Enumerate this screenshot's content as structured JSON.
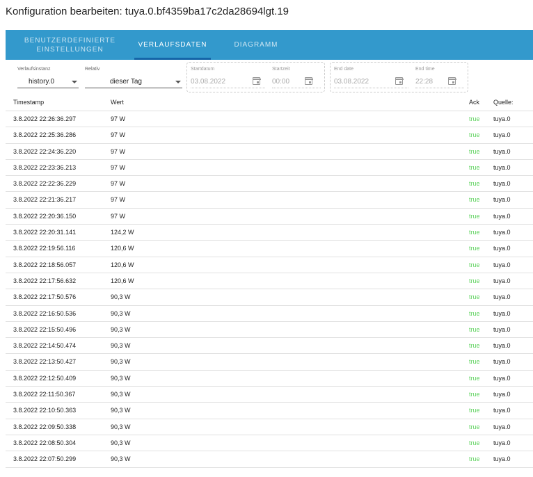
{
  "title": "Konfiguration bearbeiten: tuya.0.bf4359ba17c2da28694lgt.19",
  "tabs": [
    {
      "label_line1": "BENUTZERDEFINIERTE",
      "label_line2": "EINSTELLUNGEN"
    },
    {
      "label": "VERLAUFSDATEN"
    },
    {
      "label": "DIAGRAMM"
    }
  ],
  "controls": {
    "instance_label": "Verlaufsinstanz",
    "instance_value": "history.0",
    "relative_label": "Relativ",
    "relative_value": "dieser Tag",
    "start_date_label": "Startdatum",
    "start_date_value": "03.08.2022",
    "start_time_label": "Startzeit",
    "start_time_value": "00:00",
    "end_date_label": "End date",
    "end_date_value": "03.08.2022",
    "end_time_label": "End time",
    "end_time_value": "22:28"
  },
  "table": {
    "headers": {
      "timestamp": "Timestamp",
      "value": "Wert",
      "ack": "Ack",
      "source": "Quelle:"
    },
    "rows": [
      {
        "ts": "3.8.2022 22:26:36.297",
        "val": "97 W",
        "ack": "true",
        "src": "tuya.0"
      },
      {
        "ts": "3.8.2022 22:25:36.286",
        "val": "97 W",
        "ack": "true",
        "src": "tuya.0"
      },
      {
        "ts": "3.8.2022 22:24:36.220",
        "val": "97 W",
        "ack": "true",
        "src": "tuya.0"
      },
      {
        "ts": "3.8.2022 22:23:36.213",
        "val": "97 W",
        "ack": "true",
        "src": "tuya.0"
      },
      {
        "ts": "3.8.2022 22:22:36.229",
        "val": "97 W",
        "ack": "true",
        "src": "tuya.0"
      },
      {
        "ts": "3.8.2022 22:21:36.217",
        "val": "97 W",
        "ack": "true",
        "src": "tuya.0"
      },
      {
        "ts": "3.8.2022 22:20:36.150",
        "val": "97 W",
        "ack": "true",
        "src": "tuya.0"
      },
      {
        "ts": "3.8.2022 22:20:31.141",
        "val": "124,2 W",
        "ack": "true",
        "src": "tuya.0"
      },
      {
        "ts": "3.8.2022 22:19:56.116",
        "val": "120,6 W",
        "ack": "true",
        "src": "tuya.0"
      },
      {
        "ts": "3.8.2022 22:18:56.057",
        "val": "120,6 W",
        "ack": "true",
        "src": "tuya.0"
      },
      {
        "ts": "3.8.2022 22:17:56.632",
        "val": "120,6 W",
        "ack": "true",
        "src": "tuya.0"
      },
      {
        "ts": "3.8.2022 22:17:50.576",
        "val": "90,3 W",
        "ack": "true",
        "src": "tuya.0"
      },
      {
        "ts": "3.8.2022 22:16:50.536",
        "val": "90,3 W",
        "ack": "true",
        "src": "tuya.0"
      },
      {
        "ts": "3.8.2022 22:15:50.496",
        "val": "90,3 W",
        "ack": "true",
        "src": "tuya.0"
      },
      {
        "ts": "3.8.2022 22:14:50.474",
        "val": "90,3 W",
        "ack": "true",
        "src": "tuya.0"
      },
      {
        "ts": "3.8.2022 22:13:50.427",
        "val": "90,3 W",
        "ack": "true",
        "src": "tuya.0"
      },
      {
        "ts": "3.8.2022 22:12:50.409",
        "val": "90,3 W",
        "ack": "true",
        "src": "tuya.0"
      },
      {
        "ts": "3.8.2022 22:11:50.367",
        "val": "90,3 W",
        "ack": "true",
        "src": "tuya.0"
      },
      {
        "ts": "3.8.2022 22:10:50.363",
        "val": "90,3 W",
        "ack": "true",
        "src": "tuya.0"
      },
      {
        "ts": "3.8.2022 22:09:50.338",
        "val": "90,3 W",
        "ack": "true",
        "src": "tuya.0"
      },
      {
        "ts": "3.8.2022 22:08:50.304",
        "val": "90,3 W",
        "ack": "true",
        "src": "tuya.0"
      },
      {
        "ts": "3.8.2022 22:07:50.299",
        "val": "90,3 W",
        "ack": "true",
        "src": "tuya.0"
      }
    ]
  },
  "colors": {
    "tabbar": "#3399cc",
    "ack_true": "#5fd35f"
  }
}
